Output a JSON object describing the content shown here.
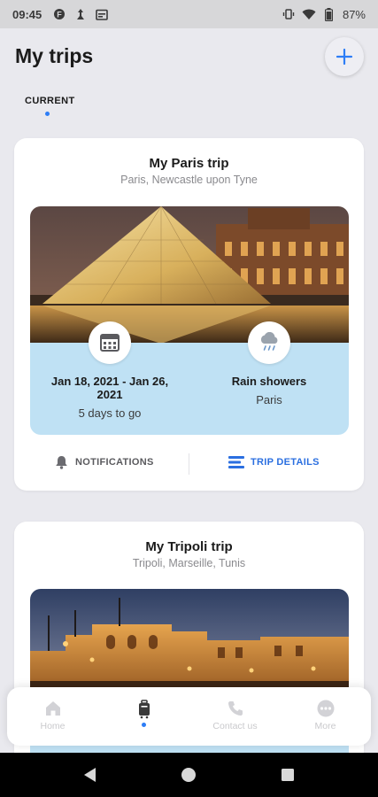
{
  "status_bar": {
    "time": "09:45",
    "battery": "87%"
  },
  "header": {
    "title": "My trips"
  },
  "tabs": [
    {
      "label": "CURRENT",
      "active": true
    }
  ],
  "trips": [
    {
      "title": "My Paris trip",
      "places": "Paris, Newcastle upon Tyne",
      "dates": "Jan 18, 2021 - Jan 26, 2021",
      "countdown": "5 days to go",
      "weather": "Rain showers",
      "weather_city": "Paris",
      "notifications_label": "NOTIFICATIONS",
      "details_label": "TRIP DETAILS"
    },
    {
      "title": "My Tripoli trip",
      "places": "Tripoli, Marseille, Tunis"
    }
  ],
  "bottom_nav": [
    {
      "label": "Home",
      "icon": "home-icon",
      "active": false
    },
    {
      "label": "",
      "icon": "trips-icon",
      "active": true
    },
    {
      "label": "Contact us",
      "icon": "phone-icon",
      "active": false
    },
    {
      "label": "More",
      "icon": "more-icon",
      "active": false
    }
  ],
  "colors": {
    "accent": "#2d7df6",
    "info_panel": "#bfe1f4",
    "details_link": "#2b6fe0"
  }
}
